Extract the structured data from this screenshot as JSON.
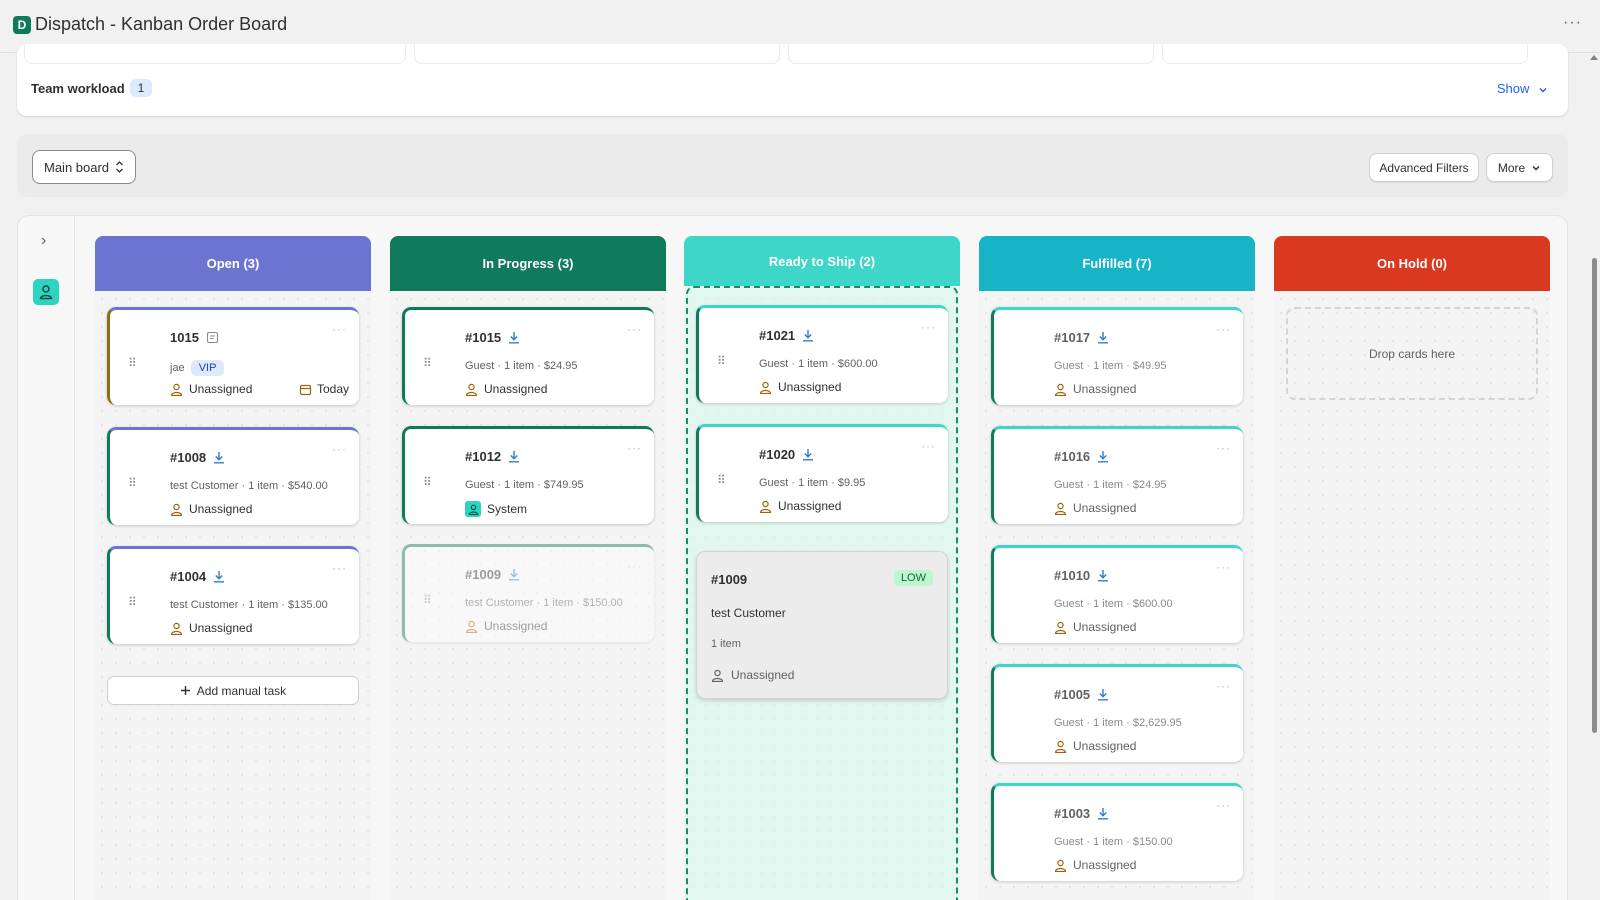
{
  "app": {
    "logo_letter": "D",
    "title": "Dispatch - Kanban Order Board"
  },
  "workload": {
    "label": "Team workload",
    "count": "1",
    "show_label": "Show"
  },
  "filters": {
    "board_name": "Main board",
    "advanced_label": "Advanced Filters",
    "more_label": "More"
  },
  "columns": [
    {
      "title": "Open (3)",
      "cards": [
        {
          "title": "1015",
          "customer": "jae",
          "tag": "VIP",
          "assignee": "Unassigned",
          "due": "Today"
        },
        {
          "title": "#1008",
          "meta": "test Customer · 1 item · $540.00",
          "assignee": "Unassigned"
        },
        {
          "title": "#1004",
          "meta": "test Customer · 1 item · $135.00",
          "assignee": "Unassigned"
        }
      ],
      "add_label": "Add manual task"
    },
    {
      "title": "In Progress (3)",
      "cards": [
        {
          "title": "#1015",
          "meta": "Guest · 1 item · $24.95",
          "assignee": "Unassigned"
        },
        {
          "title": "#1012",
          "meta": "Guest · 1 item · $749.95",
          "assignee": "System"
        },
        {
          "title": "#1009",
          "meta": "test Customer · 1 item · $150.00",
          "assignee": "Unassigned"
        }
      ]
    },
    {
      "title": "Ready to Ship (2)",
      "cards": [
        {
          "title": "#1021",
          "meta": "Guest · 1 item · $600.00",
          "assignee": "Unassigned"
        },
        {
          "title": "#1020",
          "meta": "Guest · 1 item · $9.95",
          "assignee": "Unassigned"
        }
      ],
      "ghost": {
        "title": "#1009",
        "priority": "LOW",
        "customer": "test Customer",
        "items": "1 item",
        "assignee": "Unassigned"
      }
    },
    {
      "title": "Fulfilled (7)",
      "cards": [
        {
          "title": "#1017",
          "meta": "Guest · 1 item · $49.95",
          "assignee": "Unassigned"
        },
        {
          "title": "#1016",
          "meta": "Guest · 1 item · $24.95",
          "assignee": "Unassigned"
        },
        {
          "title": "#1010",
          "meta": "Guest · 1 item · $600.00",
          "assignee": "Unassigned"
        },
        {
          "title": "#1005",
          "meta": "Guest · 1 item · $2,629.95",
          "assignee": "Unassigned"
        },
        {
          "title": "#1003",
          "meta": "Guest · 1 item · $150.00",
          "assignee": "Unassigned"
        }
      ]
    },
    {
      "title": "On Hold (0)",
      "empty_label": "Drop cards here"
    }
  ],
  "colors": {
    "open": "#6b75cf",
    "in_progress": "#127a5c",
    "ready": "#3ed6c8",
    "fulfilled": "#17b4c7",
    "on_hold": "#d9391f",
    "assignee_icon": "#a16207",
    "link": "#2563eb"
  },
  "icons": [
    "more-horizontal-icon",
    "chevron-down-icon",
    "chevron-right-icon",
    "select-arrows-icon",
    "user-icon",
    "download-icon",
    "note-icon",
    "calendar-icon",
    "plus-icon",
    "drag-handle-icon"
  ]
}
